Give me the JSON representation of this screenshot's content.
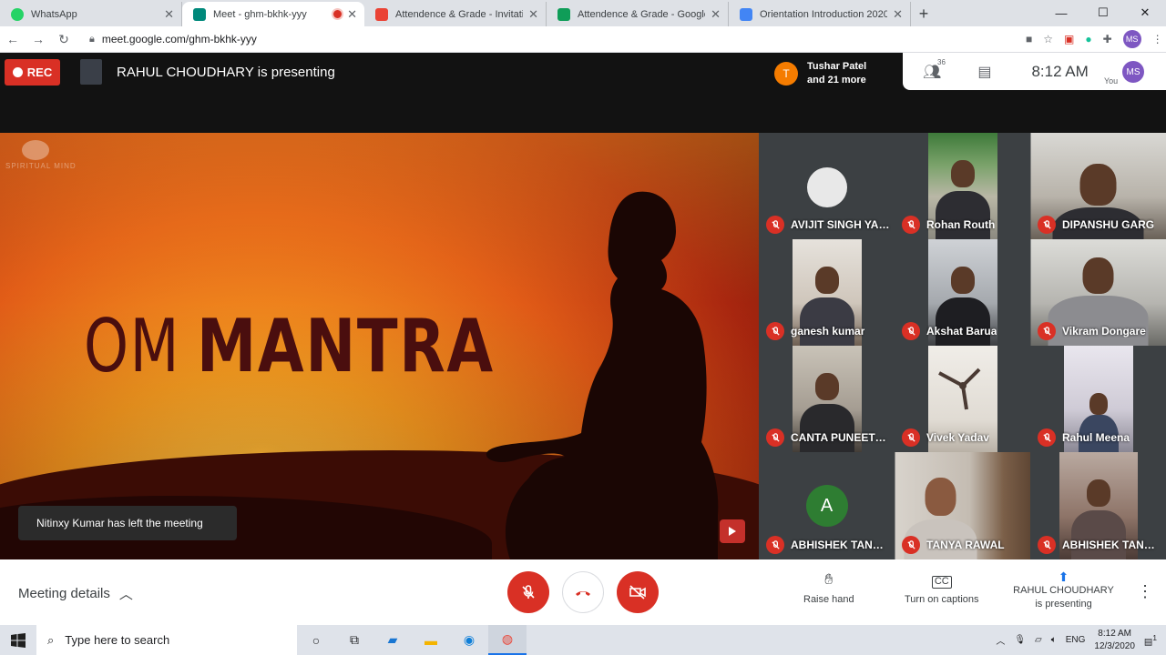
{
  "browser": {
    "tabs": [
      {
        "title": "WhatsApp",
        "favicon_color": "#25d366"
      },
      {
        "title": "Meet - ghm-bkhk-yyy",
        "favicon_color": "#00897b"
      },
      {
        "title": "Attendence & Grade - Invitation",
        "favicon_color": "#ea4335"
      },
      {
        "title": "Attendence & Grade - Google S",
        "favicon_color": "#0f9d58"
      },
      {
        "title": "Orientation Introduction 2020 -",
        "favicon_color": "#4285f4"
      }
    ],
    "url": "meet.google.com/ghm-bkhk-yyy",
    "profile_initials": "MS"
  },
  "meet": {
    "rec_label": "REC",
    "presenting_text": "RAHUL CHOUDHARY is presenting",
    "joined_chip": {
      "initial": "T",
      "line1": "Tushar Patel",
      "line2": "and 21 more"
    },
    "participant_count": "36",
    "time": "8:12 AM",
    "you_label": "You",
    "user_initials": "MS",
    "presentation": {
      "title_part1": "OM",
      "title_part2": "MANTRA",
      "logo_text": "SPIRITUAL MIND"
    },
    "toast": "Nitinxy Kumar has left the meeting",
    "participants": [
      {
        "name": "AVIJIT SINGH YAD...",
        "type": "photo"
      },
      {
        "name": "Rohan Routh",
        "type": "video"
      },
      {
        "name": "DIPANSHU GARG",
        "type": "video"
      },
      {
        "name": "ganesh kumar",
        "type": "video"
      },
      {
        "name": "Akshat Barua",
        "type": "video"
      },
      {
        "name": "Vikram Dongare",
        "type": "video"
      },
      {
        "name": "CANTA PUNEETH ...",
        "type": "video"
      },
      {
        "name": "Vivek Yadav",
        "type": "video"
      },
      {
        "name": "Rahul Meena",
        "type": "video"
      },
      {
        "name": "ABHISHEK TANWAR",
        "type": "initial",
        "initial": "A",
        "color": "#2e7d32"
      },
      {
        "name": "TANYA RAWAL",
        "type": "video"
      },
      {
        "name": "ABHISHEK TANWAR",
        "type": "video"
      }
    ],
    "controls": {
      "meeting_details": "Meeting details",
      "raise_hand": "Raise hand",
      "captions": "Turn on captions",
      "presenter_line1": "RAHUL CHOUDHARY",
      "presenter_line2": "is presenting"
    }
  },
  "taskbar": {
    "search_placeholder": "Type here to search",
    "language": "ENG",
    "clock_time": "8:12 AM",
    "clock_date": "12/3/2020",
    "notification_count": "1"
  },
  "colors": {
    "accent_red": "#d93025",
    "meet_dark": "#202124",
    "chrome_blue": "#1a73e8"
  }
}
